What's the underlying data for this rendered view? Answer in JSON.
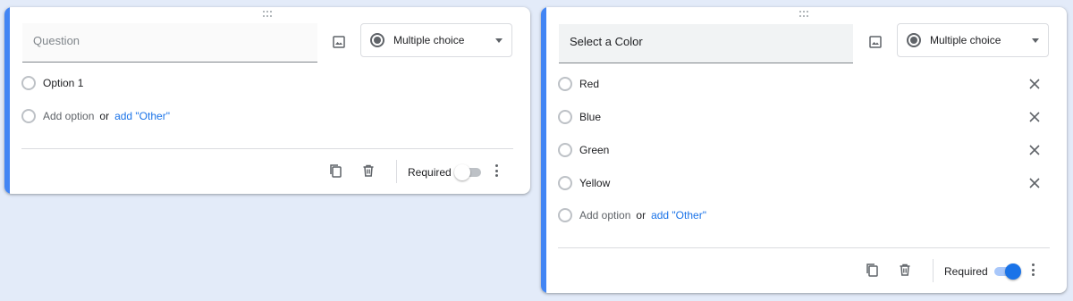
{
  "card1": {
    "question_placeholder": "Question",
    "question_value": "",
    "type_label": "Multiple choice",
    "options": [
      {
        "label": "Option 1"
      }
    ],
    "add_option": "Add option",
    "or_text": "or",
    "add_other": "add \"Other\"",
    "required_label": "Required",
    "required_on": false
  },
  "card2": {
    "question_value": "Select a Color",
    "type_label": "Multiple choice",
    "options": [
      {
        "label": "Red"
      },
      {
        "label": "Blue"
      },
      {
        "label": "Green"
      },
      {
        "label": "Yellow"
      }
    ],
    "add_option": "Add option",
    "or_text": "or",
    "add_other": "add \"Other\"",
    "required_label": "Required",
    "required_on": true
  },
  "icons": {
    "drag": "drag-handle-icon",
    "image": "image-icon",
    "type_radio": "radio-filled-icon",
    "caret": "caret-down-icon",
    "remove": "close-icon",
    "duplicate": "copy-icon",
    "delete": "trash-icon",
    "more": "more-vert-icon"
  },
  "colors": {
    "accent": "#4285f4",
    "link": "#1a73e8",
    "background": "#e3ebf9",
    "toggle_on": "#1a73e8"
  }
}
